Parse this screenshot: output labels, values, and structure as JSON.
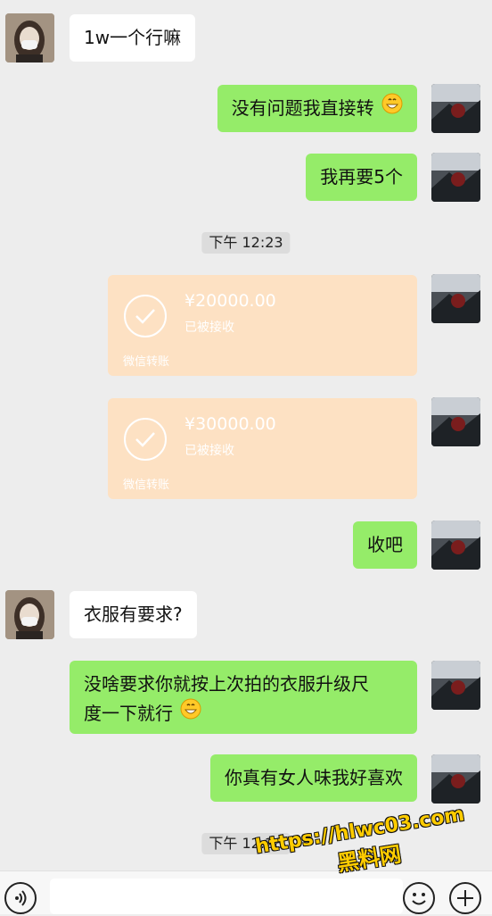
{
  "messages": {
    "m1": "1w一个行嘛",
    "m2": "没有问题我直接转",
    "m3": "我再要5个",
    "m4": "收吧",
    "m5": "衣服有要求?",
    "m6_line1": "没啥要求你就按上次拍的衣服升级尺",
    "m6_line2": "度一下就行",
    "m7": "你真有女人味我好喜欢"
  },
  "timestamps": {
    "t1": "下午 12:23",
    "t2": "下午 12:28"
  },
  "transfers": [
    {
      "amount": "¥20000.00",
      "status": "已被接收",
      "footer": "微信转账"
    },
    {
      "amount": "¥30000.00",
      "status": "已被接收",
      "footer": "微信转账"
    }
  ],
  "emoji": "grinning-face-icon",
  "watermark": {
    "line1": "https://hlwc03.com",
    "line2": "黑料网"
  },
  "colors": {
    "background": "#ededed",
    "sent_bubble": "#95ec69",
    "received_bubble": "#ffffff",
    "transfer_card": "#fde1c3",
    "watermark": "#ffcc00"
  }
}
